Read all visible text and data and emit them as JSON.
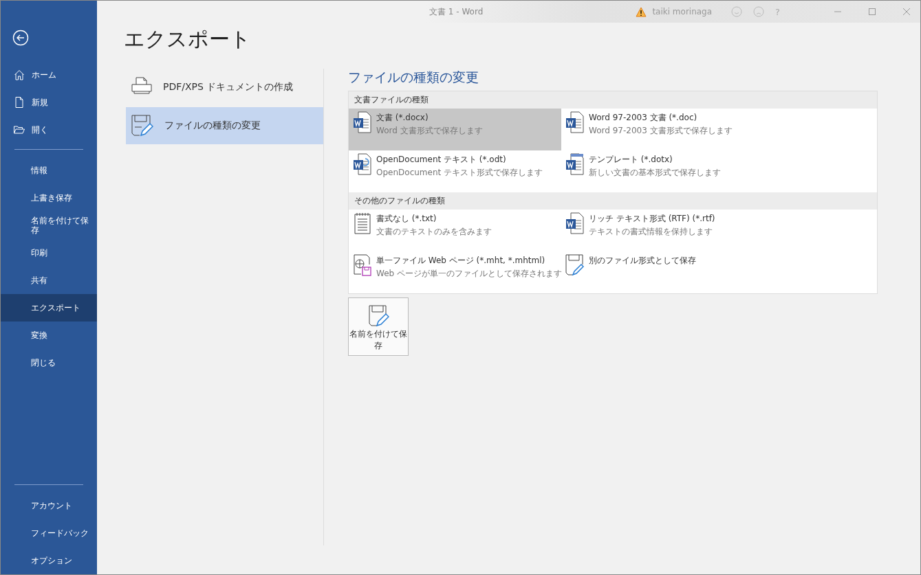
{
  "window": {
    "title": "文書 1  -  Word",
    "user": "taiki morinaga",
    "help": "?"
  },
  "sidebar": {
    "top_items": [
      {
        "label": "ホーム",
        "kind": "home",
        "selected": false
      },
      {
        "label": "新規",
        "kind": "new",
        "selected": false
      },
      {
        "label": "開く",
        "kind": "open",
        "selected": false
      }
    ],
    "items": [
      {
        "label": "情報",
        "selected": false
      },
      {
        "label": "上書き保存",
        "selected": false
      },
      {
        "label": "名前を付けて保存",
        "selected": false
      },
      {
        "label": "印刷",
        "selected": false
      },
      {
        "label": "共有",
        "selected": false
      },
      {
        "label": "エクスポート",
        "selected": true
      },
      {
        "label": "変換",
        "selected": false
      },
      {
        "label": "閉じる",
        "selected": false
      }
    ],
    "bottom_items": [
      {
        "label": "アカウント",
        "selected": false
      },
      {
        "label": "フィードバック",
        "selected": false
      },
      {
        "label": "オプション",
        "selected": false
      }
    ]
  },
  "page_title": "エクスポート",
  "export_options": [
    {
      "label": "PDF/XPS ドキュメントの作成",
      "kind": "pdf",
      "selected": false
    },
    {
      "label": "ファイルの種類の変更",
      "kind": "change",
      "selected": true
    }
  ],
  "file_types": {
    "heading": "ファイルの種類の変更",
    "sections": [
      {
        "title": "文書ファイルの種類",
        "items": [
          {
            "name": "文書 (*.docx)",
            "description": "Word 文書形式で保存します",
            "kind": "word",
            "selected": true
          },
          {
            "name": "Word 97-2003 文書 (*.doc)",
            "description": "Word 97-2003 文書形式で保存します",
            "kind": "word",
            "selected": false
          },
          {
            "name": "OpenDocument テキスト (*.odt)",
            "description": "OpenDocument テキスト形式で保存します",
            "kind": "odt",
            "selected": false
          },
          {
            "name": "テンプレート (*.dotx)",
            "description": "新しい文書の基本形式で保存します",
            "kind": "template",
            "selected": false
          }
        ]
      },
      {
        "title": "その他のファイルの種類",
        "items": [
          {
            "name": "書式なし (*.txt)",
            "description": "文書のテキストのみを含みます",
            "kind": "text",
            "selected": false
          },
          {
            "name": "リッチ テキスト形式 (RTF) (*.rtf)",
            "description": "テキストの書式情報を保持します",
            "kind": "word",
            "selected": false
          },
          {
            "name": "単一ファイル Web ページ (*.mht, *.mhtml)",
            "description": "Web ページが単一のファイルとして保存されます",
            "kind": "web",
            "selected": false
          },
          {
            "name": "別のファイル形式として保存",
            "kind": "other",
            "selected": false
          }
        ]
      }
    ],
    "save_button": "名前を付けて保存"
  }
}
